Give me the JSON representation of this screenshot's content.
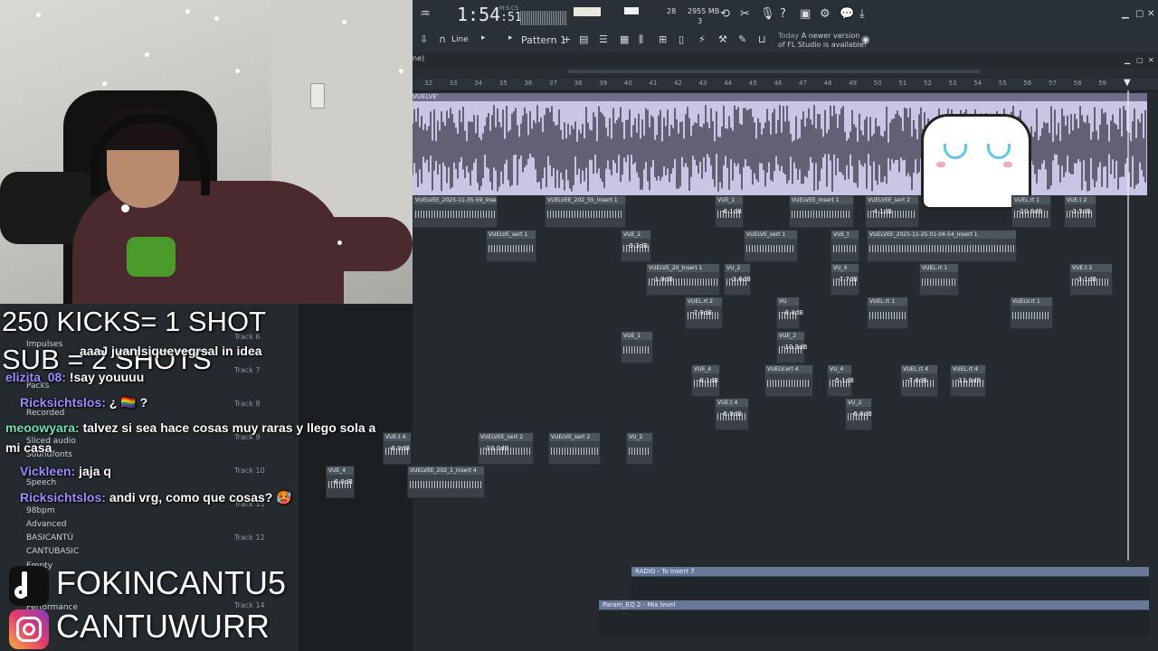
{
  "overlay": {
    "headline1": "250 KICKS= 1 SHOT",
    "headline2": "SUB = 2 SHOTS",
    "tiktok": "FOKINCANTU5",
    "instagram": "CANTUWURR"
  },
  "chat": [
    {
      "user": "",
      "text": "aaaJ juanlsiquevegrsal in idea"
    },
    {
      "user": "elizita_08:",
      "text": "!say youuuu"
    },
    {
      "user": "Ricksichtslos:",
      "text": "¿ 🏳️‍🌈 ?"
    },
    {
      "user": "meoowyara:",
      "text": "talvez si sea hace cosas muy raras y llego sola a"
    },
    {
      "user": "",
      "text": "mi casa"
    },
    {
      "user": "Vickleen:",
      "text": "jaja q"
    },
    {
      "user": "Ricksichtslos:",
      "text": "andi vrg, como que cosas? 🥵"
    }
  ],
  "browser": [
    "Impulses",
    "Packs",
    "Recorded",
    "Sliced audio",
    "Soundfonts",
    "Speech",
    "98bpm",
    "Advanced",
    "BASICANTÚ",
    "CANTUBASIC",
    "Empty",
    "Performance"
  ],
  "topbar": {
    "time": "1:54",
    "time_small": "51",
    "time_unit": "M:S:CS",
    "cpu_mem": "2955 MB",
    "cpu_num": "3",
    "num28": "28",
    "pattern": "Pattern 1",
    "line": "Line",
    "update_day": "Today",
    "update_msg": "A newer version of FL Studio is available!"
  },
  "playlist": {
    "title": "ne)",
    "wave_label": "VUELVE'",
    "ruler": [
      "32",
      "33",
      "34",
      "35",
      "36",
      "37",
      "38",
      "39",
      "40",
      "41",
      "42",
      "43",
      "44",
      "45",
      "46",
      "47",
      "48",
      "49",
      "50",
      "51",
      "52",
      "53",
      "54",
      "55",
      "56",
      "57",
      "58",
      "59"
    ],
    "tracks": [
      "Track 6",
      "Track 7",
      "Track 8",
      "Track 9",
      "Track 10",
      "Track 11",
      "Track 12",
      "Track 14"
    ],
    "clips": [
      {
        "label": "VUELVEE_2025-11-35-59_Insert 1",
        "db": ""
      },
      {
        "label": "VUELVEE_202_55_Insert 1",
        "db": ""
      },
      {
        "label": "VUE_1",
        "db": "-6.1dB"
      },
      {
        "label": "VUELVEE_Insert 1",
        "db": ""
      },
      {
        "label": "VUELVEE_sert 2",
        "db": "-4.1dB"
      },
      {
        "label": "VUEL.rt 1",
        "db": "-10.6dB"
      },
      {
        "label": "VUE.t 2",
        "db": "-3.5dB"
      },
      {
        "label": "VUELVE_sert 1",
        "db": ""
      },
      {
        "label": "VUE_2",
        "db": "-9.3dB"
      },
      {
        "label": "VUELVE_sert 1",
        "db": ""
      },
      {
        "label": "VUE_t",
        "db": ""
      },
      {
        "label": "VUELVEE_2025-11-25 01-04-54_Insert 1",
        "db": ""
      },
      {
        "label": "VUELVE_20_Insert 1",
        "db": "-1.9dB"
      },
      {
        "label": "VU_2",
        "db": "-3.6dB"
      },
      {
        "label": "VU_4",
        "db": "-7.7dB"
      },
      {
        "label": "VUEL.rt 1",
        "db": ""
      },
      {
        "label": "VUE.t 2",
        "db": "-3.1dB"
      },
      {
        "label": "VUEL.rt 2",
        "db": "-7.9dB"
      },
      {
        "label": "VU",
        "db": "-8.4dB"
      },
      {
        "label": "VUEL.rt 1",
        "db": ""
      },
      {
        "label": "VUELV.rt 1",
        "db": ""
      },
      {
        "label": "VUE_1",
        "db": ""
      },
      {
        "label": "VUE_2",
        "db": "-10.3dB"
      },
      {
        "label": "VUE_4",
        "db": "-8.1dB"
      },
      {
        "label": "VUELV.ert 4",
        "db": ""
      },
      {
        "label": "VU_4",
        "db": "-5.1dB"
      },
      {
        "label": "VUEL.rt 4",
        "db": "-7.6dB"
      },
      {
        "label": "VUEL.rt 4",
        "db": "-11.9dB"
      },
      {
        "label": "VUE.t 4",
        "db": "-6.9dB"
      },
      {
        "label": "VU_2",
        "db": "-6.6dB"
      },
      {
        "label": "VUE.t 4",
        "db": "-8.0dB"
      },
      {
        "label": "VUELVEE_sert 2",
        "db": "-10.0dB"
      },
      {
        "label": "VUELVE_sert 2",
        "db": ""
      },
      {
        "label": "VU_2",
        "db": ""
      },
      {
        "label": "VUE_4",
        "db": "-6.0dB"
      },
      {
        "label": "VUELVEE_202_1_Insert 4",
        "db": ""
      }
    ],
    "automation": [
      {
        "label": "RADIO - To Insert 7"
      },
      {
        "label": "Param_EQ 2 - Mix level"
      }
    ]
  }
}
